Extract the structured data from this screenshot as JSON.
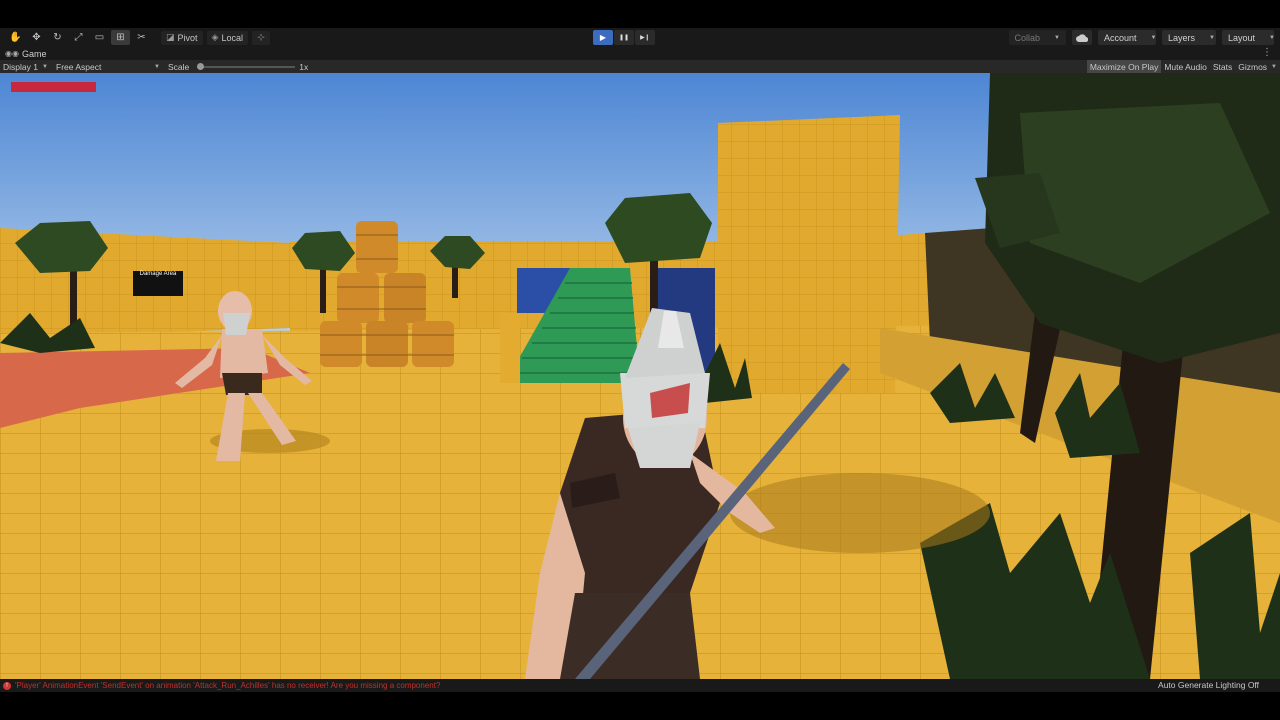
{
  "toolbar": {
    "tools": [
      {
        "name": "hand-tool",
        "icon": "✋"
      },
      {
        "name": "move-tool",
        "icon": "✥"
      },
      {
        "name": "rotate-tool",
        "icon": "↻"
      },
      {
        "name": "scale-tool",
        "icon": "⤢"
      },
      {
        "name": "rect-tool",
        "icon": "▭"
      },
      {
        "name": "transform-tool",
        "icon": "⊞"
      },
      {
        "name": "custom-tool",
        "icon": "✂"
      }
    ],
    "pivot_label": "Pivot",
    "local_label": "Local",
    "play_icon": "▶",
    "pause_icon": "❚❚",
    "step_icon": "▶❙",
    "collab_label": "Collab",
    "account_label": "Account",
    "layers_label": "Layers",
    "layout_label": "Layout"
  },
  "game_tab": {
    "label": "Game",
    "menu_icon": "⋮"
  },
  "game_bar": {
    "display": "Display 1",
    "aspect": "Free Aspect",
    "scale_label": "Scale",
    "scale_value": "1x",
    "scale_fraction": 0.0,
    "maximize_on_play": "Maximize On Play",
    "mute_audio": "Mute Audio",
    "stats": "Stats",
    "gizmos": "Gizmos"
  },
  "scene": {
    "sign_text": "Damage Area",
    "health_fraction": 1.0,
    "health_color": "#c8283e"
  },
  "status": {
    "error_message": "'Player' AnimationEvent 'SendEvent' on animation 'Attack_Run_Achilles' has no receiver! Are you missing a component?",
    "lighting_label": "Auto Generate Lighting Off"
  },
  "colors": {
    "accent_play": "#3c6cbf",
    "error": "#c4302b",
    "floor": "#e8b43a",
    "sky": "#5a92d8"
  }
}
